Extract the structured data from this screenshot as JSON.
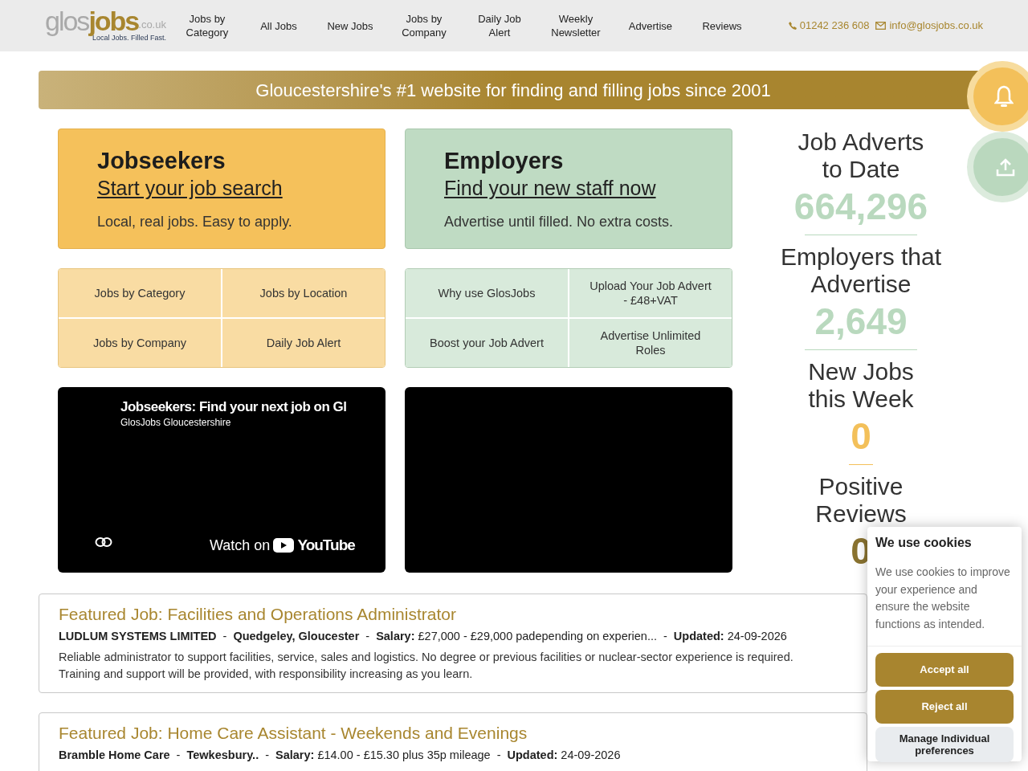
{
  "header": {
    "logo": {
      "word_1": "glos",
      "word_2": "jobs",
      "suffix": ".co.uk",
      "tagline": "Local Jobs. Filled Fast."
    },
    "nav": [
      "Jobs by Category",
      "All Jobs",
      "New Jobs",
      "Jobs by Company",
      "Daily Job Alert",
      "Weekly Newsletter",
      "Advertise",
      "Reviews"
    ],
    "phone": "01242 236 608",
    "email": "info@glosjobs.co.uk"
  },
  "banner": "Gloucestershire's #1 website for finding and filling jobs since 2001",
  "panels": [
    {
      "kind": "jobseekers",
      "title": "Jobseekers",
      "link": "Start your job search",
      "text": "Local, real jobs. Easy to apply.",
      "tiles": [
        "Jobs by Category",
        "Jobs by Location",
        "Jobs by Company",
        "Daily Job Alert"
      ]
    },
    {
      "kind": "employers",
      "title": "Employers",
      "link": "Find your new staff now",
      "text": "Advertise until filled. No extra costs.",
      "tiles": [
        "Why use GlosJobs",
        "Upload Your Job Advert - £48+VAT",
        "Boost your Job Advert",
        "Advertise Unlimited Roles"
      ]
    }
  ],
  "videos": [
    {
      "kind": "youtube",
      "title": "Jobseekers: Find your next job on Gl",
      "channel": "GlosJobs Gloucestershire",
      "watch": "Watch on",
      "brand": "YouTube"
    },
    {
      "kind": "blank"
    }
  ],
  "stats": [
    {
      "label": "Job Adverts to Date",
      "value": "664,296",
      "color": "#b9d9be"
    },
    {
      "label": "Employers that Advertise",
      "value": "2,649",
      "color": "#b9d9be"
    },
    {
      "label": "New Jobs this Week",
      "value": "0",
      "color": "#f3c05a"
    },
    {
      "label": "Positive Reviews",
      "value": "0",
      "color": "#8a7330"
    }
  ],
  "featured_jobs": [
    {
      "title": "Featured Job: Facilities and Operations Administrator",
      "company": "LUDLUM SYSTEMS LIMITED",
      "location": "Quedgeley, Gloucester",
      "separator": "-",
      "salary_label": "Salary:",
      "salary": "£27,000 - £29,000 padepending on experien...",
      "updated_label": "Updated:",
      "updated": "24-09-2026",
      "description": "Reliable administrator to support facilities, service, sales and logistics. No degree or previous facilities or nuclear-sector experience is required. Training and support will be provided, with responsibility increasing as you learn."
    },
    {
      "title": "Featured Job: Home Care Assistant - Weekends and Evenings",
      "company": "Bramble Home Care",
      "location": "Tewkesbury..",
      "separator": "-",
      "salary_label": "Salary:",
      "salary": "£14.00 - £15.30 plus 35p mileage",
      "updated_label": "Updated:",
      "updated": "24-09-2026"
    }
  ],
  "cookie_popup": {
    "title": "We use cookies",
    "text": "We use cookies to improve your experience and ensure the website functions as intended.",
    "buttons": [
      {
        "label": "Accept all",
        "kind": "primary"
      },
      {
        "label": "Reject all",
        "kind": "primary"
      },
      {
        "label": "Manage Individual preferences",
        "kind": "secondary"
      }
    ]
  }
}
